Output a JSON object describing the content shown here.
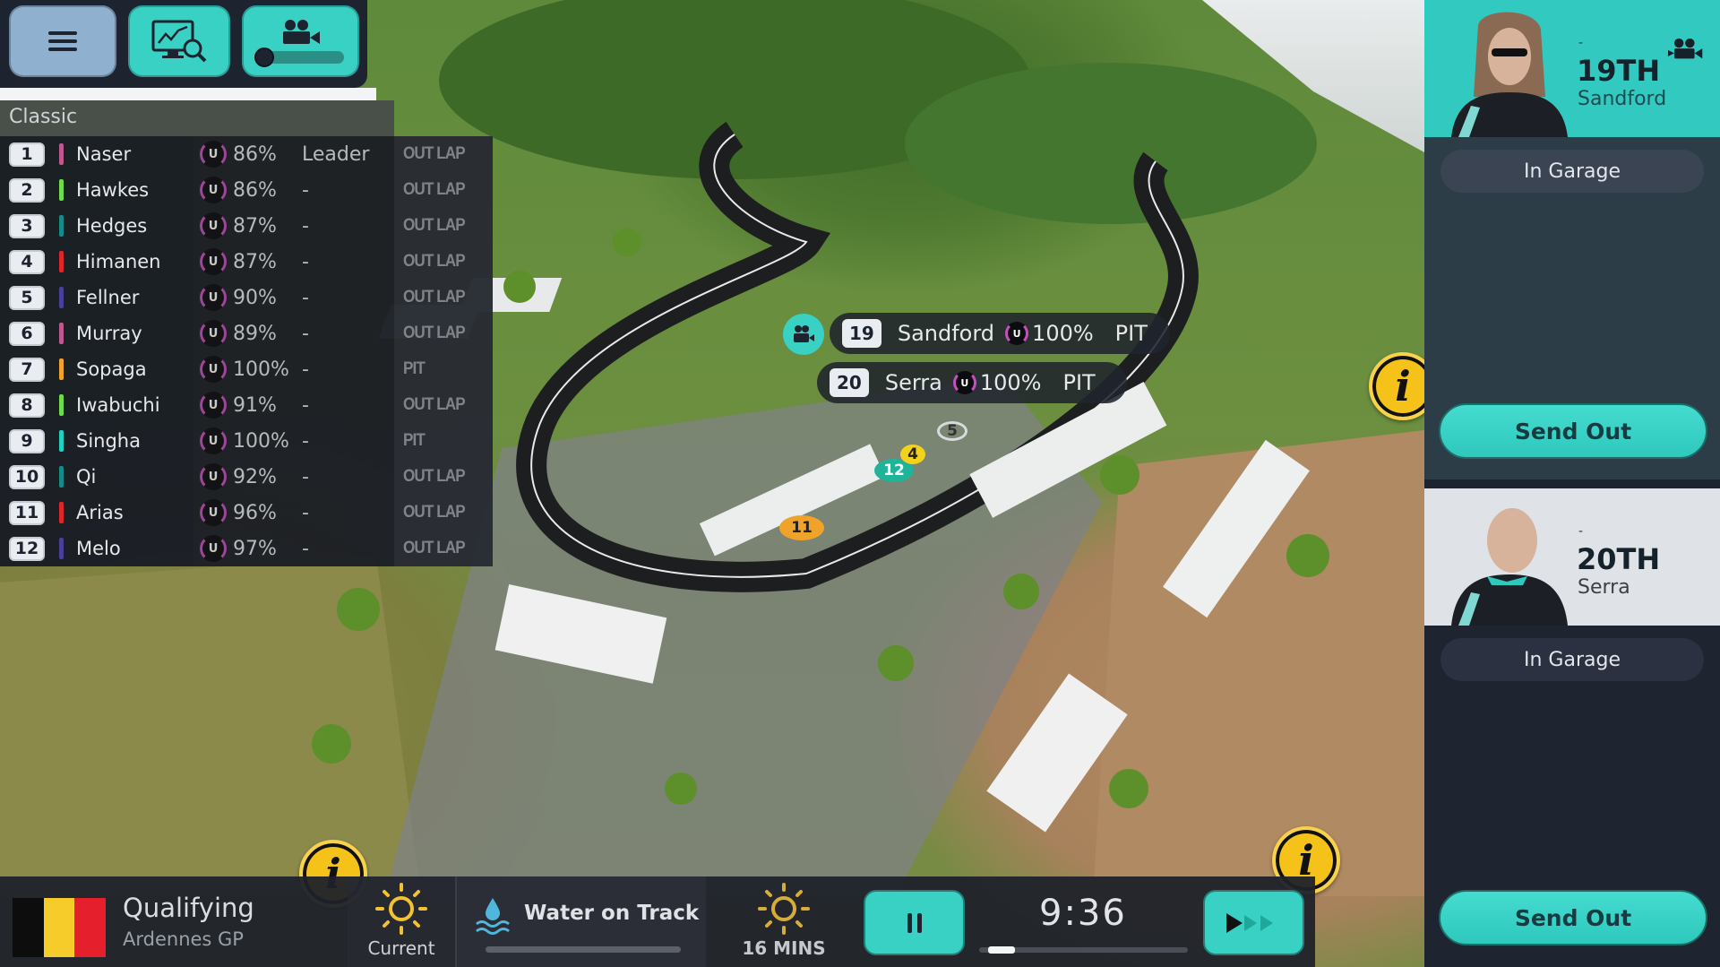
{
  "toolbar": {
    "menu_icon": "hamburger-menu-icon",
    "analysis_icon": "monitor-chart-magnifier-icon",
    "camera_icon": "video-camera-icon",
    "camera_zoom_level": 0.0
  },
  "standings": {
    "title": "Classic",
    "rows": [
      {
        "pos": "1",
        "name": "Naser",
        "team_color": "#c0578f",
        "tyre": "U",
        "condition": "86%",
        "gap": "Leader",
        "status": "OUT LAP"
      },
      {
        "pos": "2",
        "name": "Hawkes",
        "team_color": "#6fdc4a",
        "tyre": "U",
        "condition": "86%",
        "gap": "-",
        "status": "OUT LAP"
      },
      {
        "pos": "3",
        "name": "Hedges",
        "team_color": "#138c88",
        "tyre": "U",
        "condition": "87%",
        "gap": "-",
        "status": "OUT LAP"
      },
      {
        "pos": "4",
        "name": "Himanen",
        "team_color": "#e0262a",
        "tyre": "U",
        "condition": "87%",
        "gap": "-",
        "status": "OUT LAP"
      },
      {
        "pos": "5",
        "name": "Fellner",
        "team_color": "#4b3f9c",
        "tyre": "U",
        "condition": "90%",
        "gap": "-",
        "status": "OUT LAP"
      },
      {
        "pos": "6",
        "name": "Murray",
        "team_color": "#c0578f",
        "tyre": "U",
        "condition": "89%",
        "gap": "-",
        "status": "OUT LAP"
      },
      {
        "pos": "7",
        "name": "Sopaga",
        "team_color": "#f2a22a",
        "tyre": "U",
        "condition": "100%",
        "gap": "-",
        "status": "PIT"
      },
      {
        "pos": "8",
        "name": "Iwabuchi",
        "team_color": "#6fdc4a",
        "tyre": "U",
        "condition": "91%",
        "gap": "-",
        "status": "OUT LAP"
      },
      {
        "pos": "9",
        "name": "Singha",
        "team_color": "#20d1bd",
        "tyre": "U",
        "condition": "100%",
        "gap": "-",
        "status": "PIT"
      },
      {
        "pos": "10",
        "name": "Qi",
        "team_color": "#138c88",
        "tyre": "U",
        "condition": "92%",
        "gap": "-",
        "status": "OUT LAP"
      },
      {
        "pos": "11",
        "name": "Arias",
        "team_color": "#e0262a",
        "tyre": "U",
        "condition": "96%",
        "gap": "-",
        "status": "OUT LAP"
      },
      {
        "pos": "12",
        "name": "Melo",
        "team_color": "#4b3f9c",
        "tyre": "U",
        "condition": "97%",
        "gap": "-",
        "status": "OUT LAP"
      }
    ]
  },
  "track_labels": [
    {
      "num": "19",
      "name": "Sandford",
      "tyre": "U",
      "condition": "100%",
      "status": "PIT",
      "camera": true
    },
    {
      "num": "20",
      "name": "Serra",
      "tyre": "U",
      "condition": "100%",
      "status": "PIT",
      "camera": false
    }
  ],
  "car_markers": [
    {
      "num": "11",
      "color": "#f0a32a"
    },
    {
      "num": "12",
      "color": "#1fb39a"
    },
    {
      "num": "4",
      "color": "#f2d21a"
    },
    {
      "num": "5",
      "color": "#d8dadc"
    }
  ],
  "drivers": [
    {
      "dash": "-",
      "place": "19TH",
      "name": "Sandford",
      "status": "In Garage",
      "action": "Send Out",
      "camera_icon": "video-camera-icon"
    },
    {
      "dash": "-",
      "place": "20TH",
      "name": "Serra",
      "status": "In Garage",
      "action": "Send Out"
    }
  ],
  "bottom": {
    "session": "Qualifying",
    "track": "Ardennes GP",
    "flag_colors": [
      "#0d0d0d",
      "#f5cc2a",
      "#e51f2c"
    ],
    "weather_current_label": "Current",
    "water_label": "Water on Track",
    "water_level": 0.0,
    "forecast_label": "16 MINS",
    "clock": "9:36",
    "session_progress": 0.05
  },
  "colors": {
    "accent": "#39d1c4",
    "info": "#f5c21a",
    "panel_dark": "#1d232f",
    "tyre_ring": "#c64fc0"
  }
}
